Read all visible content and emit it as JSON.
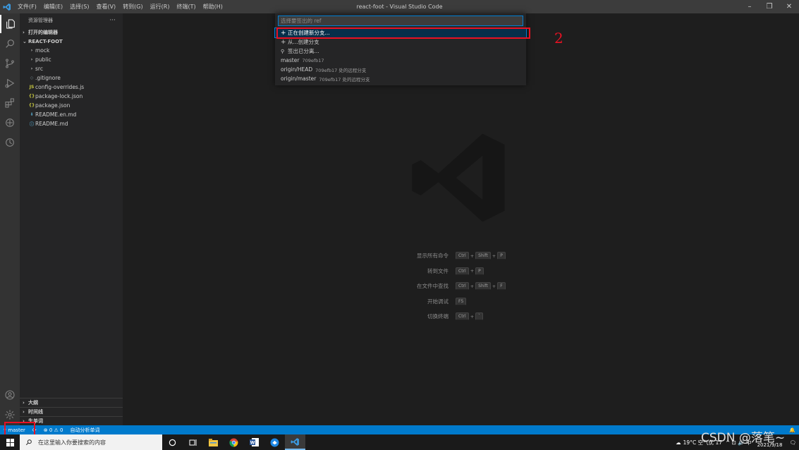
{
  "titlebar": {
    "title": "react-foot - Visual Studio Code",
    "menu": [
      "文件(F)",
      "编辑(E)",
      "选择(S)",
      "查看(V)",
      "转到(G)",
      "运行(R)",
      "终端(T)",
      "帮助(H)"
    ],
    "controls": {
      "minimize": "–",
      "maximize": "❐",
      "close": "✕"
    }
  },
  "sidebar": {
    "title": "资源管理器",
    "more": "···",
    "open_editors": "打开的编辑器",
    "project": "REACT-FOOT",
    "folders": [
      "mock",
      "public",
      "src"
    ],
    "files": [
      {
        "icon": "◇",
        "name": ".gitignore",
        "color": "#6d8086"
      },
      {
        "icon": "JS",
        "name": "config-overrides.js",
        "color": "#cbcb41"
      },
      {
        "icon": "{}",
        "name": "package-lock.json",
        "color": "#cbcb41"
      },
      {
        "icon": "{}",
        "name": "package.json",
        "color": "#cbcb41"
      },
      {
        "icon": "⬇",
        "name": "README.en.md",
        "color": "#519aba"
      },
      {
        "icon": "ⓘ",
        "name": "README.md",
        "color": "#519aba"
      }
    ],
    "bottom_sections": [
      "大纲",
      "时间线",
      "生单词"
    ]
  },
  "quickpick": {
    "placeholder": "选择要签出的 ref",
    "items": [
      {
        "icon": "+",
        "label": "正在创建新分支...",
        "desc": ""
      },
      {
        "icon": "+",
        "label": "从...创建分支",
        "desc": ""
      },
      {
        "icon": "⚲",
        "label": "签出已分离...",
        "desc": ""
      },
      {
        "icon": "",
        "label": "master",
        "desc": "709efb17"
      },
      {
        "icon": "",
        "label": "origin/HEAD",
        "desc": "709efb17 处的远程分支"
      },
      {
        "icon": "",
        "label": "origin/master",
        "desc": "709efb17 处的远程分支"
      }
    ]
  },
  "annotation": {
    "number": "2",
    "color": "#e81123"
  },
  "shortcuts": [
    {
      "label": "显示所有命令",
      "keys": [
        "Ctrl",
        "Shift",
        "P"
      ]
    },
    {
      "label": "转到文件",
      "keys": [
        "Ctrl",
        "P"
      ]
    },
    {
      "label": "在文件中查找",
      "keys": [
        "Ctrl",
        "Shift",
        "F"
      ]
    },
    {
      "label": "开始调试",
      "keys": [
        "F5"
      ]
    },
    {
      "label": "切换终端",
      "keys": [
        "Ctrl",
        "`"
      ]
    }
  ],
  "statusbar": {
    "branch": "master",
    "sync": "⟳",
    "problems": "⊗ 0 ⚠ 0",
    "extension": "自动分析单词",
    "right": "🔔"
  },
  "taskbar": {
    "search_placeholder": "在这里输入你要搜索的内容",
    "weather": "19°C 空气优 17",
    "tray_symbols": "^ ⊡ 🔊 中",
    "date": "2021/9/18",
    "watermark": "CSDN @落笔~"
  },
  "colors": {
    "accent": "#007acc",
    "annotation": "#e81123",
    "titlebar": "#3c3c3c"
  }
}
